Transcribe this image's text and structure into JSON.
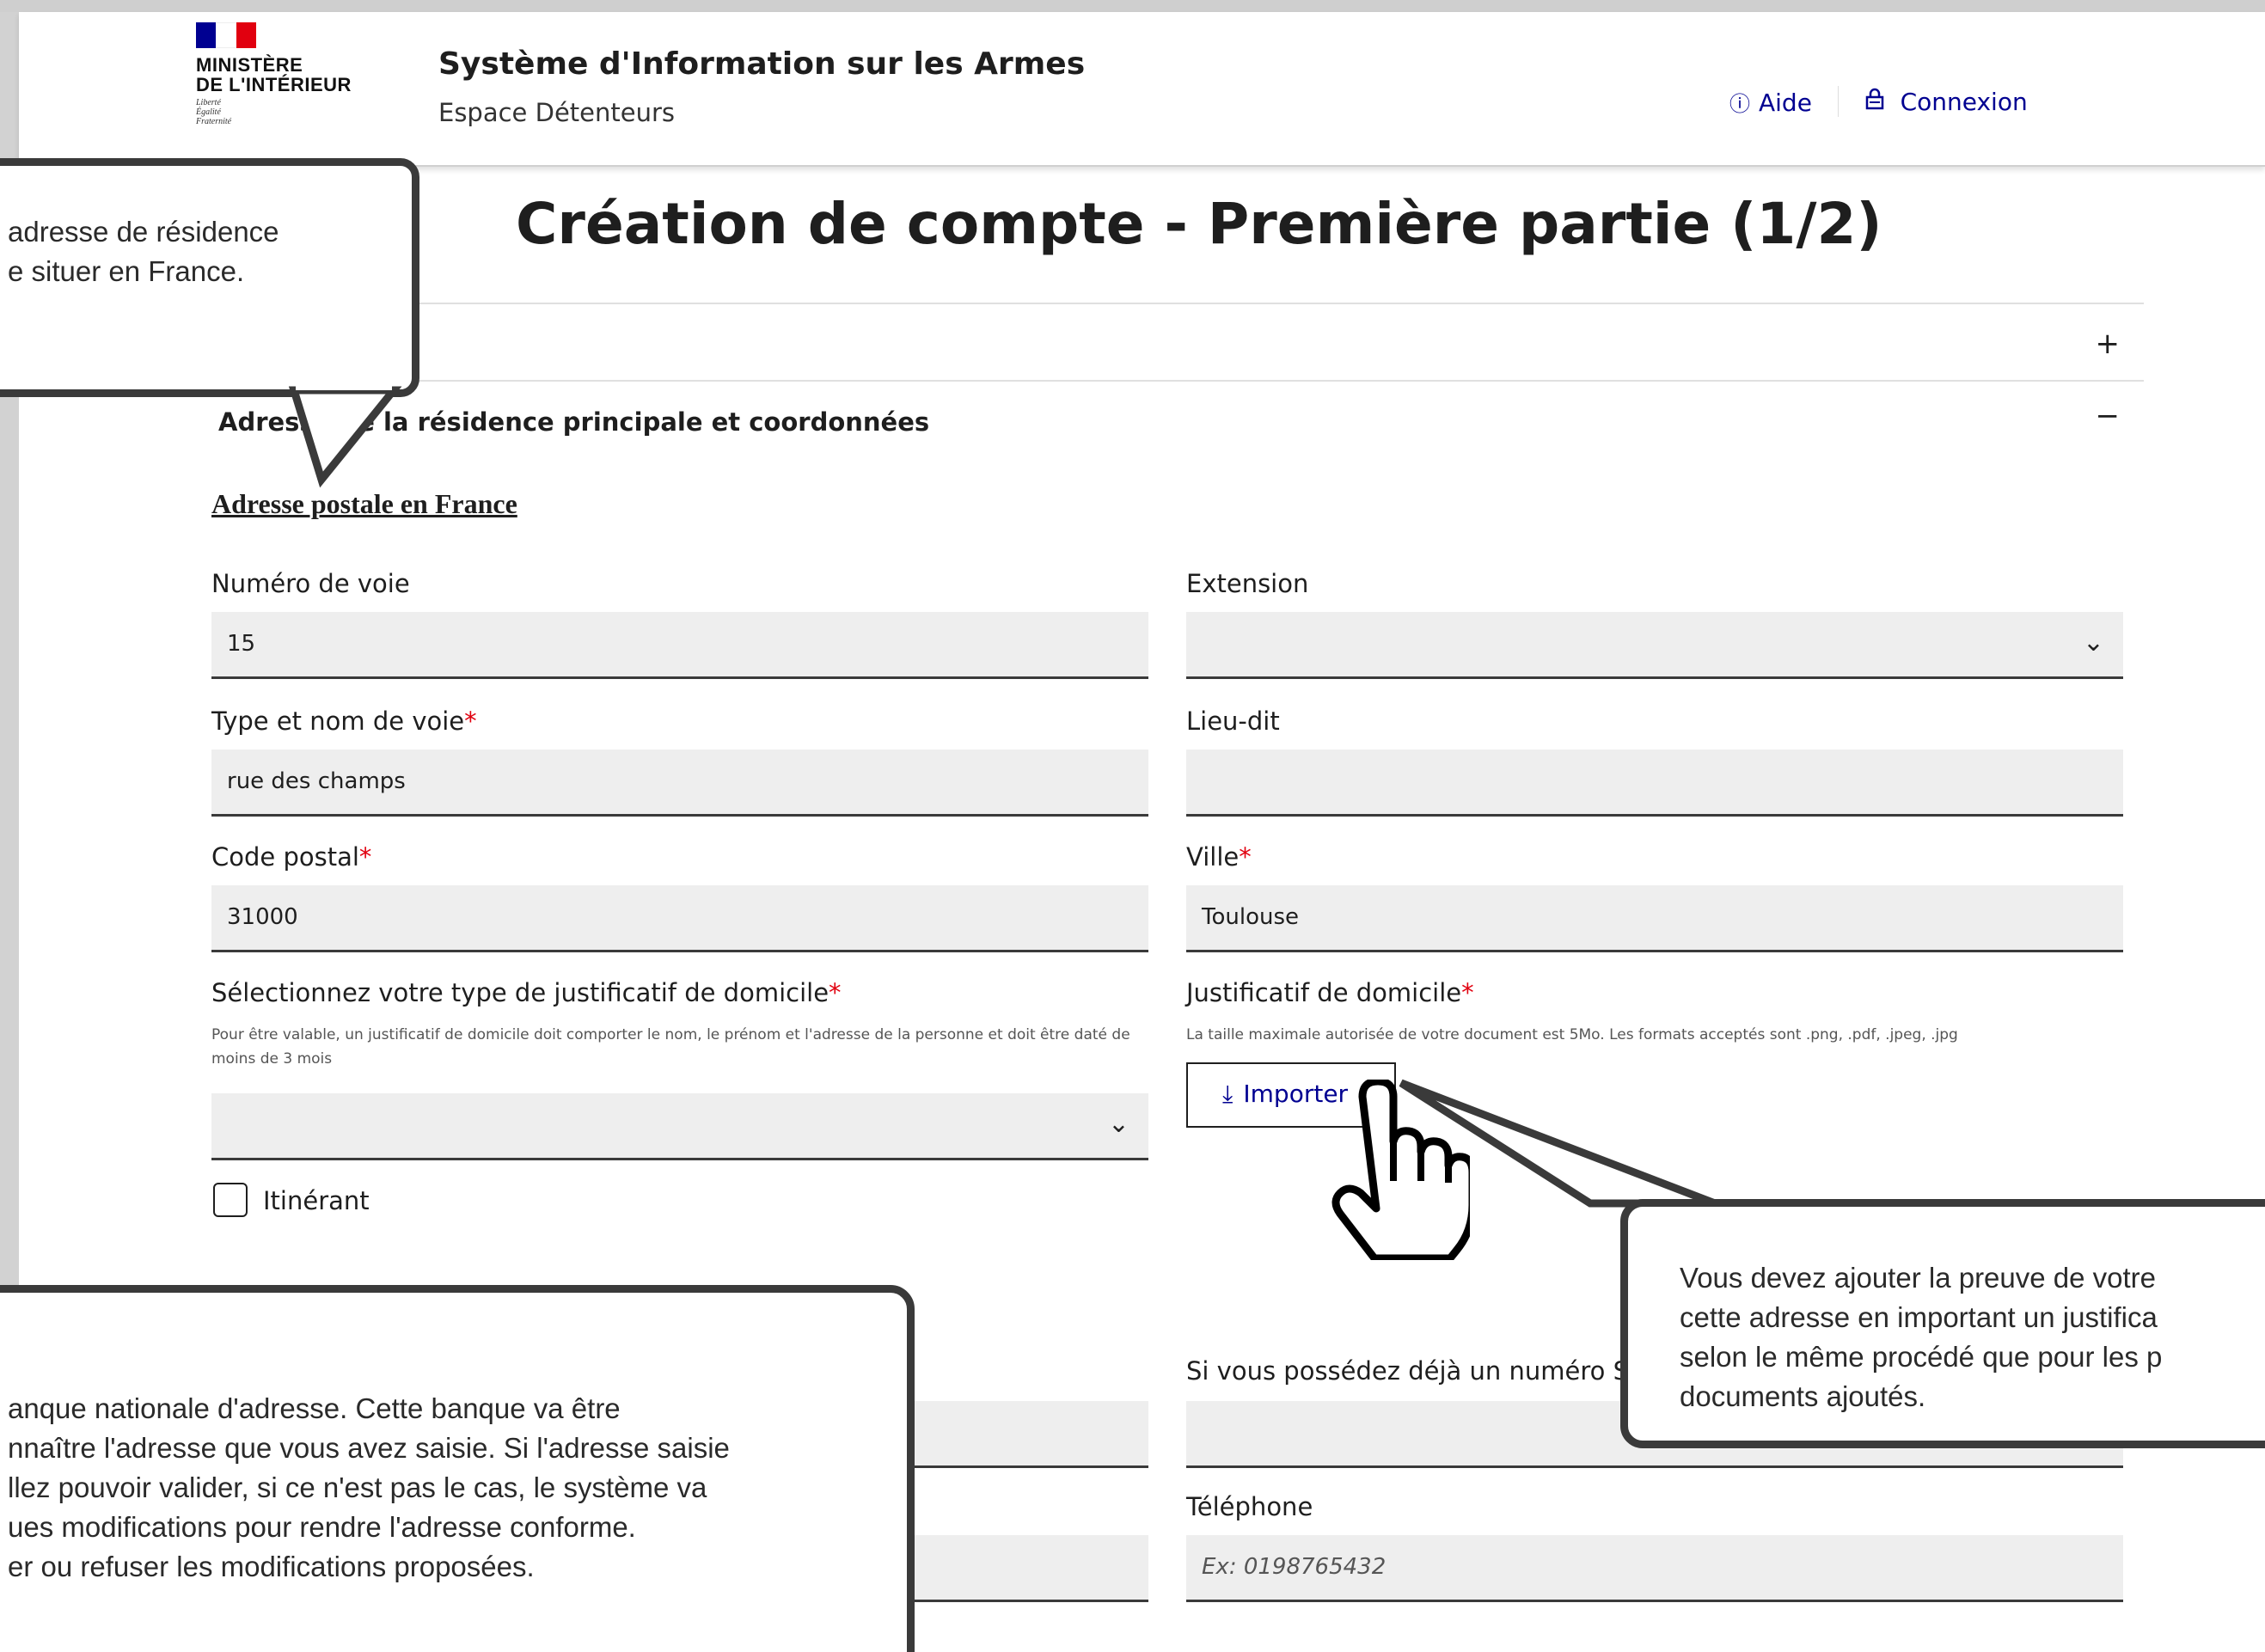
{
  "header": {
    "ministry_line1": "MINISTÈRE",
    "ministry_line2": "DE L'INTÉRIEUR",
    "motto": [
      "Liberté",
      "Égalité",
      "Fraternité"
    ],
    "site_title": "Système d'Information sur les Armes",
    "site_subtitle": "Espace Détenteurs",
    "help_link": "Aide",
    "login_link": "Connexion"
  },
  "page_title": "Création de compte - Première partie (1/2)",
  "accordion": {
    "collapsed_sign": "+",
    "expanded_sign": "−",
    "section_label": "Adresse de la résidence principale et coordonnées"
  },
  "form": {
    "section_title": "Adresse postale en France",
    "numero_voie": {
      "label": "Numéro de voie",
      "value": "15"
    },
    "extension": {
      "label": "Extension",
      "value": ""
    },
    "type_nom_voie": {
      "label": "Type et nom de voie",
      "value": "rue des champs"
    },
    "lieu_dit": {
      "label": "Lieu-dit",
      "value": ""
    },
    "code_postal": {
      "label": "Code postal",
      "value": "31000"
    },
    "ville": {
      "label": "Ville",
      "value": "Toulouse"
    },
    "justificatif_type": {
      "label": "Sélectionnez votre type de justificatif de domicile",
      "hint": "Pour être valable, un justificatif de domicile doit comporter le nom, le prénom et l'adresse de la personne et doit être daté de moins de 3 mois",
      "value": ""
    },
    "justificatif": {
      "label": "Justificatif de domicile",
      "hint": "La taille maximale autorisée de votre document est 5Mo. Les formats acceptés sont .png, .pdf, .jpeg, .jpg",
      "button": "Importer"
    },
    "itinerant_label": "Itinérant",
    "sia_label": "Si vous possédez déjà un numéro SIA,",
    "telephone": {
      "label": "Téléphone",
      "placeholder": "Ex: 0198765432"
    },
    "required_mark": "*"
  },
  "callouts": {
    "top": [
      "adresse de résidence",
      "e situer en France."
    ],
    "bottom": [
      "anque nationale d'adresse. Cette banque va être",
      "nnaître l'adresse que vous avez saisie. Si l'adresse saisie",
      "llez pouvoir valider, si ce n'est pas le cas, le système va",
      "ues modifications pour rendre l'adresse conforme.",
      "er ou refuser les modifications proposées."
    ],
    "right": [
      "Vous devez ajouter la preuve de votre",
      "cette adresse en important un justifica",
      "selon le même procédé que pour les p",
      "documents ajoutés."
    ]
  },
  "icons": {
    "help": "info-circle-icon",
    "login": "lock-icon",
    "import": "download-icon",
    "select": "chevron-down-icon",
    "cursor": "hand-pointer-icon"
  }
}
